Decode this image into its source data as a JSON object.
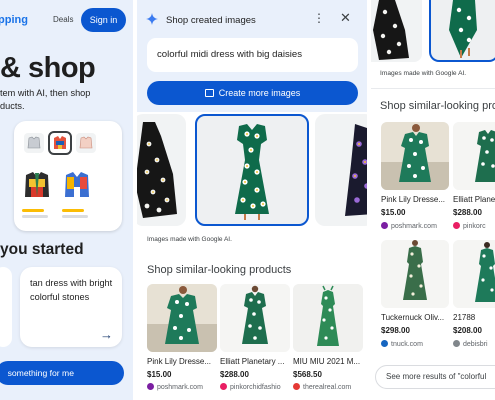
{
  "panel_left": {
    "brand": "pping",
    "deals_label": "Deals",
    "signin_label": "Sign in",
    "headline": "& shop",
    "subtext_line1": "tem with AI, then shop",
    "subtext_line2": "ducts.",
    "started_heading": "you started",
    "idea_text": "tan dress with bright colorful stones",
    "arrow_glyph": "→",
    "cta_label": "something for me"
  },
  "panel_middle": {
    "header_title": "Shop created images",
    "kebab_glyph": "⋮",
    "close_glyph": "✕",
    "prompt_text": "colorful midi dress with big daisies",
    "create_more_label": "Create more images",
    "gallery_caption": "Images made with Google AI.",
    "similar_heading": "Shop similar-looking products",
    "products": [
      {
        "name": "Pink Lily Dresse...",
        "price": "$15.00",
        "store": "poshmark.com",
        "dot_color": "#7b1fa2",
        "dress_color": "#1e7a5a"
      },
      {
        "name": "Elliatt Planetary ...",
        "price": "$288.00",
        "store": "pinkorchidfashio",
        "dot_color": "#e91e63",
        "dress_color": "#1e6e4e"
      },
      {
        "name": "MIU MIU 2021 M...",
        "price": "$568.50",
        "store": "therealreal.com",
        "dot_color": "#e53935",
        "dress_color": "#2e8b57"
      }
    ]
  },
  "panel_right": {
    "gallery_caption": "Images made with Google AI.",
    "similar_heading": "Shop similar-looking produ",
    "products": [
      {
        "name": "Pink Lily Dresse...",
        "price": "$15.00",
        "store": "poshmark.com",
        "dot_color": "#7b1fa2",
        "dress_color": "#1e7a5a"
      },
      {
        "name": "Elliatt Plane",
        "price": "$288.00",
        "store": "pinkorc",
        "dot_color": "#e91e63",
        "dress_color": "#1e6e4e"
      },
      {
        "name": "Tuckernuck Oliv...",
        "price": "$298.00",
        "store": "tnuck.com",
        "dot_color": "#1565c0",
        "dress_color": "#3a6e4a"
      },
      {
        "name": "21788",
        "price": "$208.00",
        "store": "debisbri",
        "dot_color": "#80868b",
        "dress_color": "#1e7a5a"
      }
    ],
    "see_more_label": "See more results of \"colorful"
  },
  "colors": {
    "accent": "#0b57d0",
    "header_bg": "#e9f0fb",
    "star": "#fbbc04",
    "daisy_dress": "#0f6b4b"
  },
  "icons": [
    "sparkle-icon",
    "kebab-menu-icon",
    "close-icon",
    "image-plus-icon",
    "arrow-right-icon",
    "store-favicon-icon"
  ]
}
